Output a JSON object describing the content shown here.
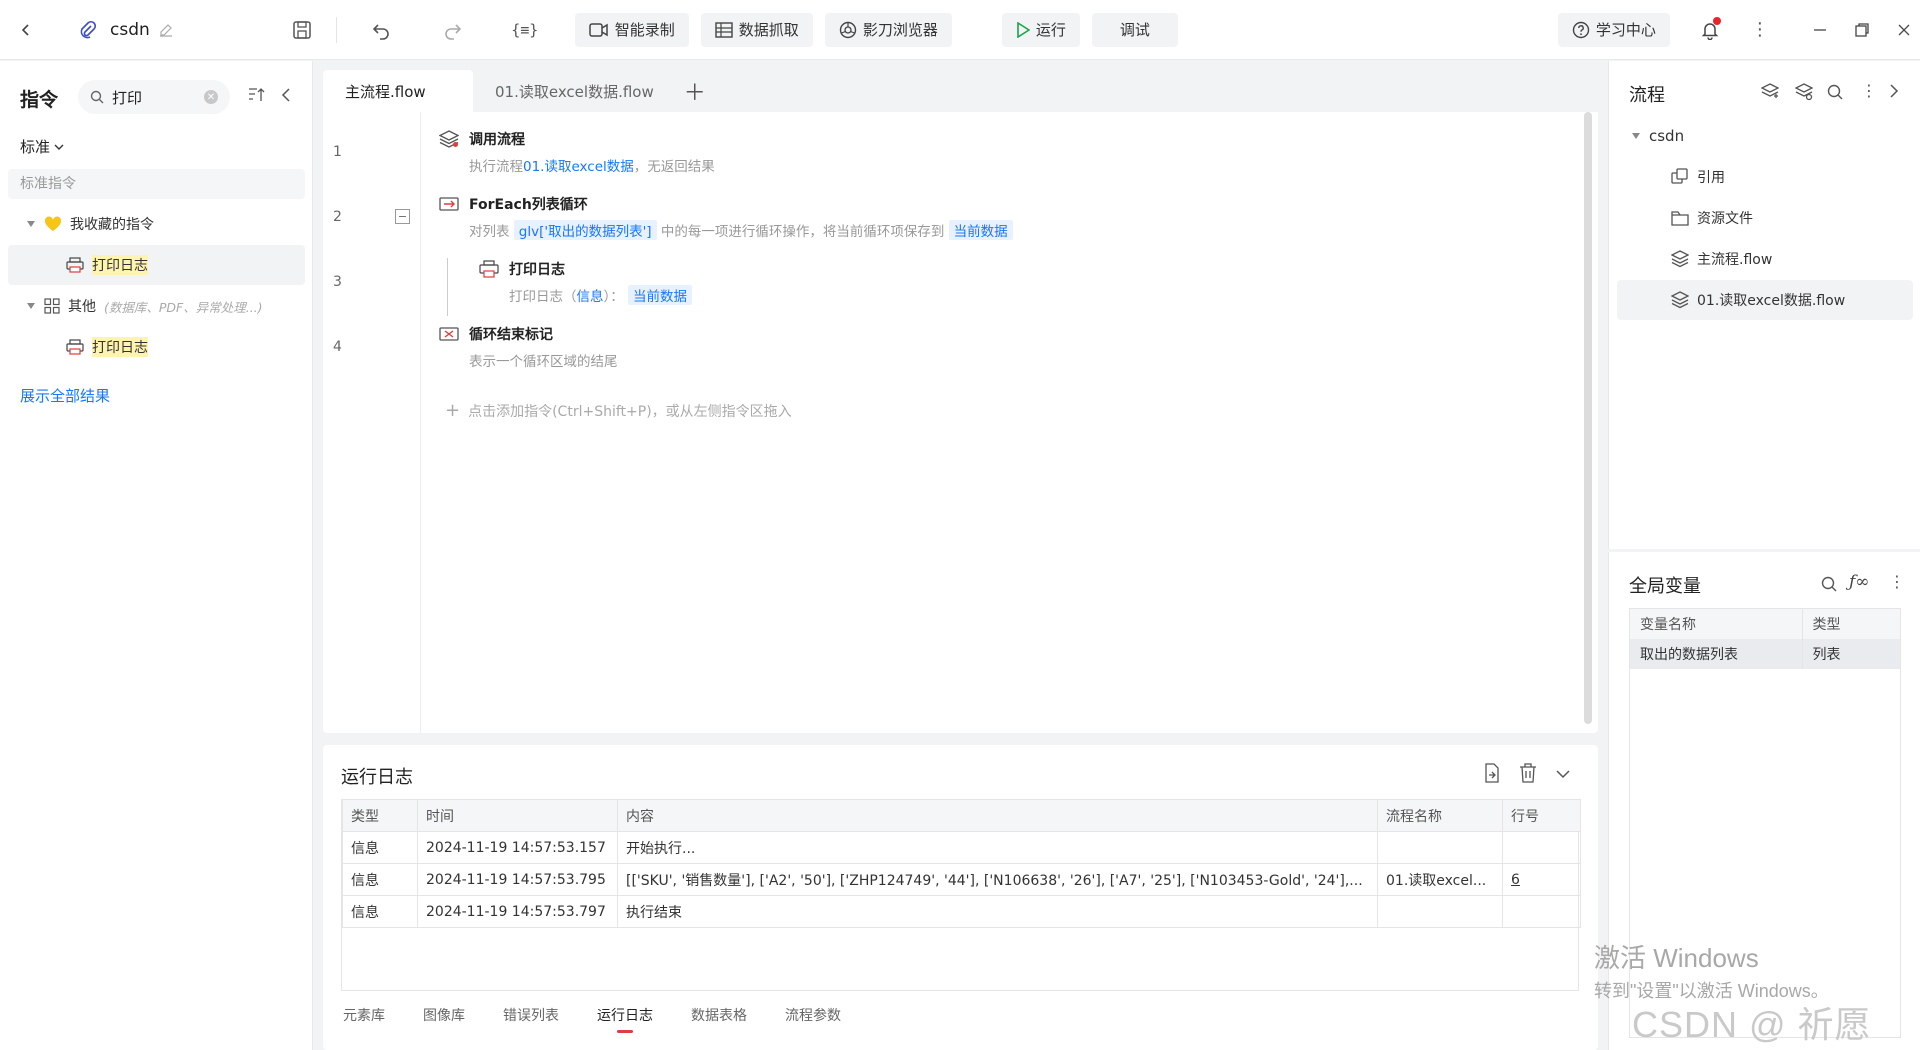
{
  "toolbar": {
    "project_name": "csdn",
    "btn_smart_record": "智能录制",
    "btn_data_capture": "数据抓取",
    "btn_browser": "影刀浏览器",
    "btn_run": "运行",
    "btn_debug": "调试",
    "btn_learning": "学习中心"
  },
  "left": {
    "title": "指令",
    "search_value": "打印",
    "category_dropdown": "标准",
    "section_label": "标准指令",
    "favorites_group": "我收藏的指令",
    "favorites_item": "打印日志",
    "other_group": "其他",
    "other_hint": "(数据库、PDF、异常处理...)",
    "other_item": "打印日志",
    "show_all": "展示全部结果"
  },
  "editor": {
    "tabs": [
      "主流程.flow",
      "01.读取excel数据.flow"
    ],
    "lines": [
      "1",
      "2",
      "3",
      "4"
    ],
    "row1": {
      "title": "调用流程",
      "sub_prefix": "执行流程",
      "sub_link": "01.读取excel数据",
      "sub_suffix": "，无返回结果"
    },
    "row2": {
      "title": "ForEach列表循环",
      "sub_prefix": "对列表",
      "tag1": "glv['取出的数据列表']",
      "sub_mid": "中的每一项进行循环操作，将当前循环项保存到",
      "tag2": "当前数据"
    },
    "row3": {
      "title": "打印日志",
      "sub_prefix": "打印日志（",
      "sub_link": "信息",
      "sub_mid": "）：",
      "tag": "当前数据"
    },
    "row4": {
      "title": "循环结束标记",
      "sub": "表示一个循环区域的结尾"
    },
    "add_hint": "点击添加指令(Ctrl+Shift+P)，或从左侧指令区拖入"
  },
  "flow_panel": {
    "title": "流程",
    "root": "csdn",
    "items": [
      "引用",
      "资源文件",
      "主流程.flow",
      "01.读取excel数据.flow"
    ]
  },
  "vars_panel": {
    "title": "全局变量",
    "headers": [
      "变量名称",
      "类型"
    ],
    "rows": [
      [
        "取出的数据列表",
        "列表"
      ]
    ]
  },
  "log": {
    "title": "运行日志",
    "headers": [
      "类型",
      "时间",
      "内容",
      "流程名称",
      "行号"
    ],
    "rows": [
      [
        "信息",
        "2024-11-19 14:57:53.157",
        "开始执行...",
        "",
        ""
      ],
      [
        "信息",
        "2024-11-19 14:57:53.795",
        "[['SKU', '销售数量'], ['A2', '50'], ['ZHP124749', '44'], ['N106638', '26'], ['A7', '25'], ['N103453-Gold', '24'],...",
        "01.读取excel...",
        "6"
      ],
      [
        "信息",
        "2024-11-19 14:57:53.797",
        "执行结束",
        "",
        ""
      ]
    ],
    "bottom_tabs": [
      "元素库",
      "图像库",
      "错误列表",
      "运行日志",
      "数据表格",
      "流程参数"
    ]
  },
  "watermarks": {
    "win_line1": "激活 Windows",
    "win_line2": "转到\"设置\"以激活 Windows。",
    "csdn": "CSDN @ 祈愿"
  },
  "colors": {
    "accent": "#1677ff",
    "badge": "#e8252b",
    "tag_bg": "#e8f1ff"
  }
}
